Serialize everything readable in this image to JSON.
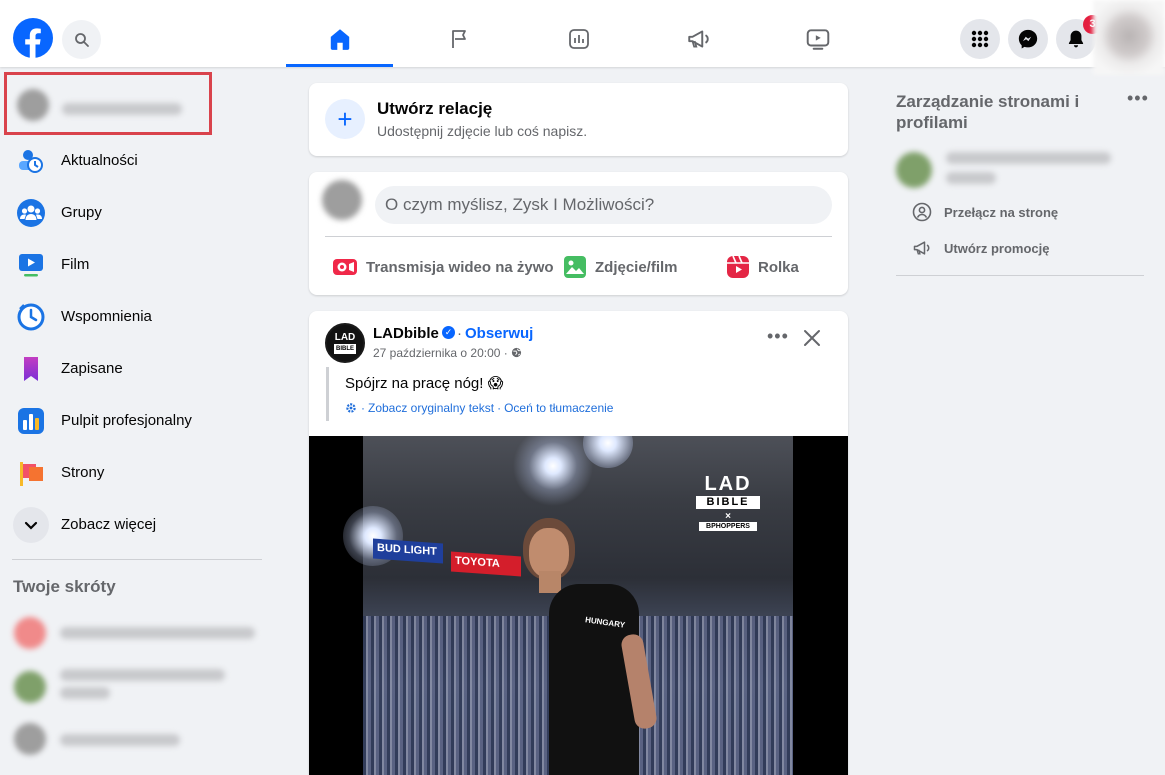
{
  "topbar": {
    "logo": "facebook-logo",
    "search_icon": "search-icon",
    "nav_tabs": [
      {
        "name": "home",
        "icon": "home-icon",
        "active": true
      },
      {
        "name": "pages",
        "icon": "flag-icon",
        "active": false
      },
      {
        "name": "dashboard",
        "icon": "insights-icon",
        "active": false
      },
      {
        "name": "ads",
        "icon": "megaphone-icon",
        "active": false
      },
      {
        "name": "watch",
        "icon": "video-icon",
        "active": false
      }
    ],
    "menu_icon": "grid-menu-icon",
    "messenger_icon": "messenger-icon",
    "notifications_icon": "bell-icon",
    "notifications_count": "3",
    "accent_color": "#0866ff"
  },
  "sidebar": {
    "items": [
      {
        "label": "Aktualności",
        "icon": "news-feed-icon"
      },
      {
        "label": "Grupy",
        "icon": "groups-icon"
      },
      {
        "label": "Film",
        "icon": "video-icon"
      },
      {
        "label": "Wspomnienia",
        "icon": "clock-icon"
      },
      {
        "label": "Zapisane",
        "icon": "bookmark-icon"
      },
      {
        "label": "Pulpit profesjonalny",
        "icon": "chart-icon"
      },
      {
        "label": "Strony",
        "icon": "flag-icon"
      },
      {
        "label": "Zobacz więcej",
        "icon": "chevron-down-icon"
      }
    ],
    "shortcuts_title": "Twoje skróty"
  },
  "create_story": {
    "title": "Utwórz relację",
    "subtitle": "Udostępnij zdjęcie lub coś napisz."
  },
  "composer": {
    "placeholder": "O czym myślisz, Zysk I Możliwości?",
    "actions": [
      {
        "label": "Transmisja wideo na żywo",
        "icon": "live-video-icon",
        "color": "#f02849"
      },
      {
        "label": "Zdjęcie/film",
        "icon": "photo-icon",
        "color": "#45bd62"
      },
      {
        "label": "Rolka",
        "icon": "reel-icon",
        "color": "#e42645"
      }
    ]
  },
  "post": {
    "author": "LADbible",
    "follow": "Obserwuj",
    "date": "27 października o 20:00 ·",
    "text": "Spójrz na pracę nóg! 😱",
    "translate_original": "Zobacz oryginalny tekst",
    "translate_rate": "Oceń to tłumaczenie",
    "logo_line1": "LAD",
    "logo_line2": "BIBLE",
    "video": {
      "watermark_line1": "LAD",
      "watermark_line2": "BIBLE",
      "watermark_line3": "×",
      "watermark_line4": "BPHOPPERS",
      "banner1": "BUD LIGHT",
      "banner2": "TOYOTA",
      "shirt_text": "HUNGARY"
    }
  },
  "right": {
    "title": "Zarządzanie stronami i profilami",
    "actions": [
      {
        "label": "Przełącz na stronę",
        "icon": "switch-profile-icon"
      },
      {
        "label": "Utwórz promocję",
        "icon": "megaphone-icon"
      }
    ]
  }
}
